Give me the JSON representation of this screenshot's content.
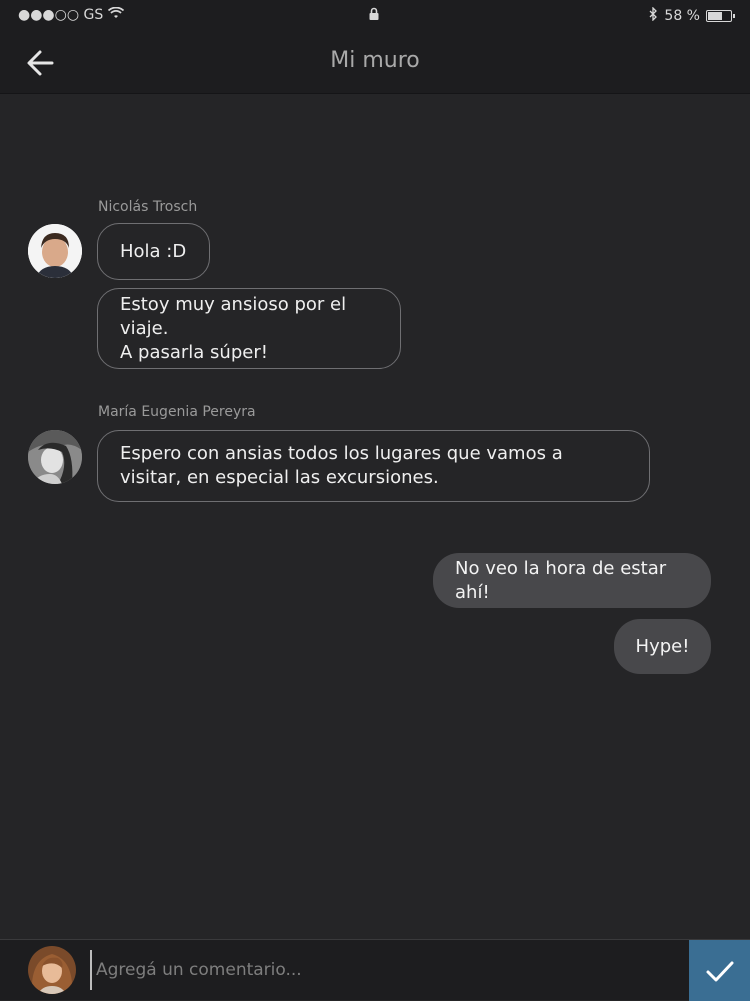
{
  "status_bar": {
    "carrier": "●●●○○ GS",
    "battery": "58 %",
    "battery_level": 0.58
  },
  "header": {
    "title": "Mi muro"
  },
  "messages": [
    {
      "sender": "Nicolás Trosch",
      "bubbles": [
        "Hola :D",
        "Estoy muy ansioso por el viaje.\nA pasarla súper!"
      ]
    },
    {
      "sender": "María Eugenia Pereyra",
      "bubbles": [
        "Espero con ansias todos los lugares que vamos a visitar, en especial las excursiones."
      ]
    }
  ],
  "own_messages": [
    "No veo la hora de estar ahí!",
    "Hype!"
  ],
  "composer": {
    "placeholder": "Agregá un comentario..."
  },
  "colors": {
    "accent": "#3a6e93",
    "background": "#252527",
    "outgoing_bubble": "#48484b"
  }
}
